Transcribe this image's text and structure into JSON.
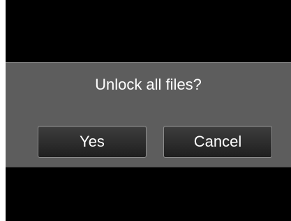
{
  "dialog": {
    "prompt": "Unlock all files?",
    "yes_label": "Yes",
    "cancel_label": "Cancel"
  },
  "colors": {
    "screen_background": "#000000",
    "dialog_background": "#5d5d5d",
    "button_background": "#2b2b2b",
    "button_border": "#8c8c8c",
    "text": "#ffffff"
  }
}
